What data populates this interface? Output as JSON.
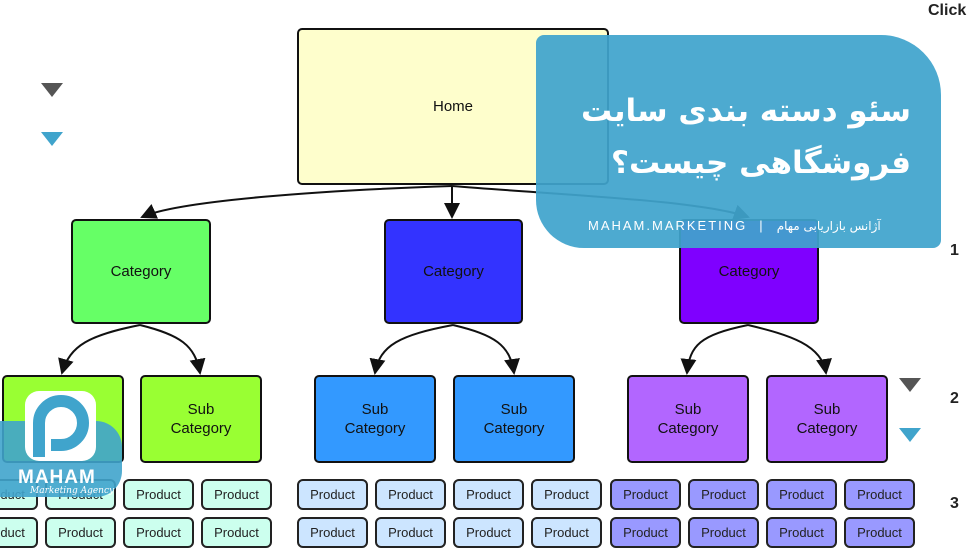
{
  "top_right_label": "Click",
  "level_numbers": [
    "1",
    "2",
    "3"
  ],
  "home": {
    "label": "Home",
    "color": "#fefecc"
  },
  "categories": [
    {
      "label": "Category",
      "color": "#66ff66",
      "sub_color": "#99ff33",
      "product_color": "#ccffee"
    },
    {
      "label": "Category",
      "color": "#3333ff",
      "sub_color": "#3399ff",
      "product_color": "#cce5ff"
    },
    {
      "label": "Category",
      "color": "#7f00ff",
      "sub_color": "#b266ff",
      "product_color": "#9999ff"
    }
  ],
  "subcategory_label": [
    "Sub",
    "Category"
  ],
  "product_label": "Product",
  "banner": {
    "title_line1": "سئو دسته بندی سایت",
    "title_line2": "فروشگاهی چیست؟",
    "site": "MAHAM.MARKETING",
    "separator": "|",
    "agency": "آژانس بازاریابی مهام",
    "color": "#40a4cc"
  },
  "logo": {
    "name": "MAHAM",
    "tagline": "Marketing Agency"
  },
  "collapse_icons": [
    "triangle-down-gray",
    "triangle-down-blue"
  ]
}
